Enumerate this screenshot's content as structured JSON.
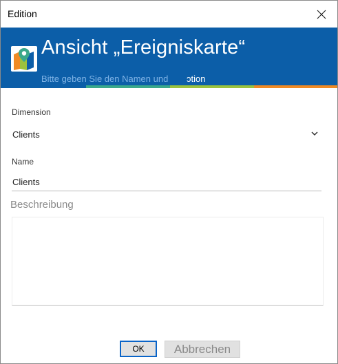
{
  "window": {
    "title": "Edition"
  },
  "banner": {
    "title": "Ansicht „Ereigniskarte“",
    "subtitle": "Bitte geben Sie den Namen und",
    "subtitle_fragment": "ɔtion",
    "logo_icon": "map-pin-icon"
  },
  "form": {
    "dimension": {
      "label": "Dimension",
      "value": "Clients"
    },
    "name": {
      "label": "Name",
      "value": "Clients"
    },
    "description": {
      "label": "Beschreibung",
      "value": ""
    }
  },
  "buttons": {
    "ok": "OK",
    "cancel": "Abbrechen"
  },
  "colors": {
    "banner": "#0c5ea8",
    "stripe": [
      "#0c5ea8",
      "#3aa88b",
      "#9bc23d",
      "#f08a24"
    ],
    "focus_border": "#0a64c8"
  }
}
